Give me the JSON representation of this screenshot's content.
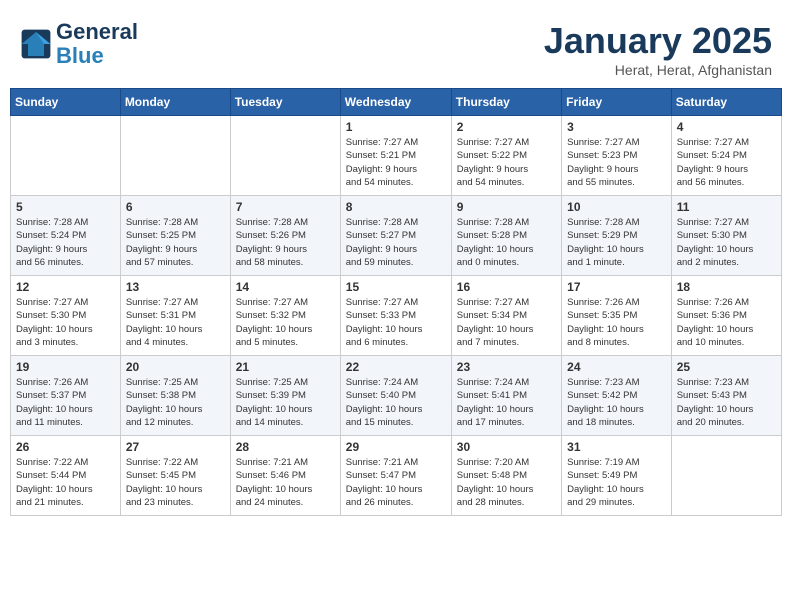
{
  "header": {
    "logo_line1": "General",
    "logo_line2": "Blue",
    "month_title": "January 2025",
    "location": "Herat, Herat, Afghanistan"
  },
  "days_of_week": [
    "Sunday",
    "Monday",
    "Tuesday",
    "Wednesday",
    "Thursday",
    "Friday",
    "Saturday"
  ],
  "weeks": [
    [
      {
        "day": "",
        "info": ""
      },
      {
        "day": "",
        "info": ""
      },
      {
        "day": "",
        "info": ""
      },
      {
        "day": "1",
        "info": "Sunrise: 7:27 AM\nSunset: 5:21 PM\nDaylight: 9 hours\nand 54 minutes."
      },
      {
        "day": "2",
        "info": "Sunrise: 7:27 AM\nSunset: 5:22 PM\nDaylight: 9 hours\nand 54 minutes."
      },
      {
        "day": "3",
        "info": "Sunrise: 7:27 AM\nSunset: 5:23 PM\nDaylight: 9 hours\nand 55 minutes."
      },
      {
        "day": "4",
        "info": "Sunrise: 7:27 AM\nSunset: 5:24 PM\nDaylight: 9 hours\nand 56 minutes."
      }
    ],
    [
      {
        "day": "5",
        "info": "Sunrise: 7:28 AM\nSunset: 5:24 PM\nDaylight: 9 hours\nand 56 minutes."
      },
      {
        "day": "6",
        "info": "Sunrise: 7:28 AM\nSunset: 5:25 PM\nDaylight: 9 hours\nand 57 minutes."
      },
      {
        "day": "7",
        "info": "Sunrise: 7:28 AM\nSunset: 5:26 PM\nDaylight: 9 hours\nand 58 minutes."
      },
      {
        "day": "8",
        "info": "Sunrise: 7:28 AM\nSunset: 5:27 PM\nDaylight: 9 hours\nand 59 minutes."
      },
      {
        "day": "9",
        "info": "Sunrise: 7:28 AM\nSunset: 5:28 PM\nDaylight: 10 hours\nand 0 minutes."
      },
      {
        "day": "10",
        "info": "Sunrise: 7:28 AM\nSunset: 5:29 PM\nDaylight: 10 hours\nand 1 minute."
      },
      {
        "day": "11",
        "info": "Sunrise: 7:27 AM\nSunset: 5:30 PM\nDaylight: 10 hours\nand 2 minutes."
      }
    ],
    [
      {
        "day": "12",
        "info": "Sunrise: 7:27 AM\nSunset: 5:30 PM\nDaylight: 10 hours\nand 3 minutes."
      },
      {
        "day": "13",
        "info": "Sunrise: 7:27 AM\nSunset: 5:31 PM\nDaylight: 10 hours\nand 4 minutes."
      },
      {
        "day": "14",
        "info": "Sunrise: 7:27 AM\nSunset: 5:32 PM\nDaylight: 10 hours\nand 5 minutes."
      },
      {
        "day": "15",
        "info": "Sunrise: 7:27 AM\nSunset: 5:33 PM\nDaylight: 10 hours\nand 6 minutes."
      },
      {
        "day": "16",
        "info": "Sunrise: 7:27 AM\nSunset: 5:34 PM\nDaylight: 10 hours\nand 7 minutes."
      },
      {
        "day": "17",
        "info": "Sunrise: 7:26 AM\nSunset: 5:35 PM\nDaylight: 10 hours\nand 8 minutes."
      },
      {
        "day": "18",
        "info": "Sunrise: 7:26 AM\nSunset: 5:36 PM\nDaylight: 10 hours\nand 10 minutes."
      }
    ],
    [
      {
        "day": "19",
        "info": "Sunrise: 7:26 AM\nSunset: 5:37 PM\nDaylight: 10 hours\nand 11 minutes."
      },
      {
        "day": "20",
        "info": "Sunrise: 7:25 AM\nSunset: 5:38 PM\nDaylight: 10 hours\nand 12 minutes."
      },
      {
        "day": "21",
        "info": "Sunrise: 7:25 AM\nSunset: 5:39 PM\nDaylight: 10 hours\nand 14 minutes."
      },
      {
        "day": "22",
        "info": "Sunrise: 7:24 AM\nSunset: 5:40 PM\nDaylight: 10 hours\nand 15 minutes."
      },
      {
        "day": "23",
        "info": "Sunrise: 7:24 AM\nSunset: 5:41 PM\nDaylight: 10 hours\nand 17 minutes."
      },
      {
        "day": "24",
        "info": "Sunrise: 7:23 AM\nSunset: 5:42 PM\nDaylight: 10 hours\nand 18 minutes."
      },
      {
        "day": "25",
        "info": "Sunrise: 7:23 AM\nSunset: 5:43 PM\nDaylight: 10 hours\nand 20 minutes."
      }
    ],
    [
      {
        "day": "26",
        "info": "Sunrise: 7:22 AM\nSunset: 5:44 PM\nDaylight: 10 hours\nand 21 minutes."
      },
      {
        "day": "27",
        "info": "Sunrise: 7:22 AM\nSunset: 5:45 PM\nDaylight: 10 hours\nand 23 minutes."
      },
      {
        "day": "28",
        "info": "Sunrise: 7:21 AM\nSunset: 5:46 PM\nDaylight: 10 hours\nand 24 minutes."
      },
      {
        "day": "29",
        "info": "Sunrise: 7:21 AM\nSunset: 5:47 PM\nDaylight: 10 hours\nand 26 minutes."
      },
      {
        "day": "30",
        "info": "Sunrise: 7:20 AM\nSunset: 5:48 PM\nDaylight: 10 hours\nand 28 minutes."
      },
      {
        "day": "31",
        "info": "Sunrise: 7:19 AM\nSunset: 5:49 PM\nDaylight: 10 hours\nand 29 minutes."
      },
      {
        "day": "",
        "info": ""
      }
    ]
  ]
}
